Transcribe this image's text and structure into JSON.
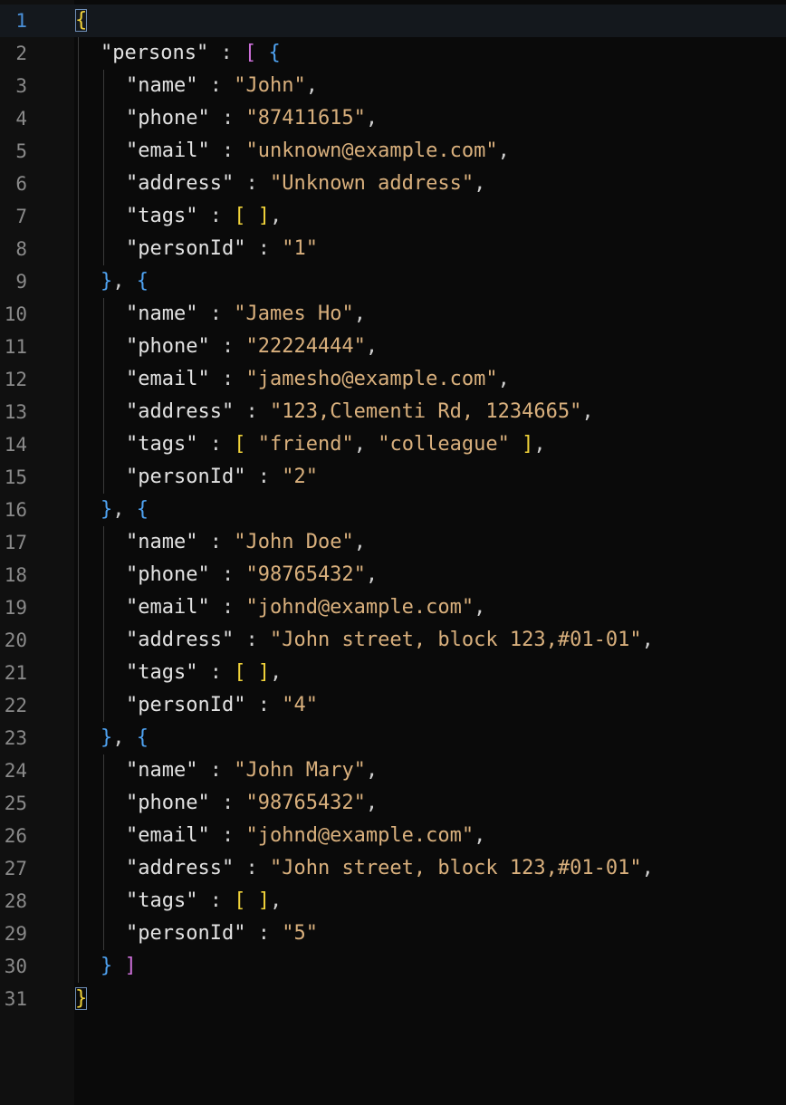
{
  "editor": {
    "colors": {
      "background": "#0a0a0a",
      "key": "#e2e2e2",
      "string": "#d9b07d",
      "bracket_level1": "#f1d33a",
      "bracket_level2": "#cc6fd8",
      "bracket_level3": "#4fa3f2",
      "line_number": "#8a8a8a",
      "current_line_number": "#4a90d9"
    },
    "current_line": 1,
    "lines": [
      {
        "n": "1",
        "indent": 0,
        "tokens": [
          {
            "t": "{",
            "c": "b1",
            "match": true
          }
        ]
      },
      {
        "n": "2",
        "indent": 1,
        "tokens": [
          {
            "t": "\"persons\"",
            "c": "key"
          },
          {
            "t": " : ",
            "c": "punc"
          },
          {
            "t": "[",
            "c": "b2"
          },
          {
            "t": " ",
            "c": "punc"
          },
          {
            "t": "{",
            "c": "b3"
          }
        ]
      },
      {
        "n": "3",
        "indent": 2,
        "tokens": [
          {
            "t": "\"name\"",
            "c": "key"
          },
          {
            "t": " : ",
            "c": "punc"
          },
          {
            "t": "\"John\"",
            "c": "str"
          },
          {
            "t": ",",
            "c": "punc"
          }
        ]
      },
      {
        "n": "4",
        "indent": 2,
        "tokens": [
          {
            "t": "\"phone\"",
            "c": "key"
          },
          {
            "t": " : ",
            "c": "punc"
          },
          {
            "t": "\"87411615\"",
            "c": "str"
          },
          {
            "t": ",",
            "c": "punc"
          }
        ]
      },
      {
        "n": "5",
        "indent": 2,
        "tokens": [
          {
            "t": "\"email\"",
            "c": "key"
          },
          {
            "t": " : ",
            "c": "punc"
          },
          {
            "t": "\"unknown@example.com\"",
            "c": "str"
          },
          {
            "t": ",",
            "c": "punc"
          }
        ]
      },
      {
        "n": "6",
        "indent": 2,
        "tokens": [
          {
            "t": "\"address\"",
            "c": "key"
          },
          {
            "t": " : ",
            "c": "punc"
          },
          {
            "t": "\"Unknown address\"",
            "c": "str"
          },
          {
            "t": ",",
            "c": "punc"
          }
        ]
      },
      {
        "n": "7",
        "indent": 2,
        "tokens": [
          {
            "t": "\"tags\"",
            "c": "key"
          },
          {
            "t": " : ",
            "c": "punc"
          },
          {
            "t": "[ ]",
            "c": "b1"
          },
          {
            "t": ",",
            "c": "punc"
          }
        ]
      },
      {
        "n": "8",
        "indent": 2,
        "tokens": [
          {
            "t": "\"personId\"",
            "c": "key"
          },
          {
            "t": " : ",
            "c": "punc"
          },
          {
            "t": "\"1\"",
            "c": "str"
          }
        ]
      },
      {
        "n": "9",
        "indent": 1,
        "tokens": [
          {
            "t": "}",
            "c": "b3"
          },
          {
            "t": ", ",
            "c": "punc"
          },
          {
            "t": "{",
            "c": "b3"
          }
        ]
      },
      {
        "n": "10",
        "indent": 2,
        "tokens": [
          {
            "t": "\"name\"",
            "c": "key"
          },
          {
            "t": " : ",
            "c": "punc"
          },
          {
            "t": "\"James Ho\"",
            "c": "str"
          },
          {
            "t": ",",
            "c": "punc"
          }
        ]
      },
      {
        "n": "11",
        "indent": 2,
        "tokens": [
          {
            "t": "\"phone\"",
            "c": "key"
          },
          {
            "t": " : ",
            "c": "punc"
          },
          {
            "t": "\"22224444\"",
            "c": "str"
          },
          {
            "t": ",",
            "c": "punc"
          }
        ]
      },
      {
        "n": "12",
        "indent": 2,
        "tokens": [
          {
            "t": "\"email\"",
            "c": "key"
          },
          {
            "t": " : ",
            "c": "punc"
          },
          {
            "t": "\"jamesho@example.com\"",
            "c": "str"
          },
          {
            "t": ",",
            "c": "punc"
          }
        ]
      },
      {
        "n": "13",
        "indent": 2,
        "tokens": [
          {
            "t": "\"address\"",
            "c": "key"
          },
          {
            "t": " : ",
            "c": "punc"
          },
          {
            "t": "\"123,Clementi Rd, 1234665\"",
            "c": "str"
          },
          {
            "t": ",",
            "c": "punc"
          }
        ]
      },
      {
        "n": "14",
        "indent": 2,
        "tokens": [
          {
            "t": "\"tags\"",
            "c": "key"
          },
          {
            "t": " : ",
            "c": "punc"
          },
          {
            "t": "[",
            "c": "b1"
          },
          {
            "t": " ",
            "c": "punc"
          },
          {
            "t": "\"friend\"",
            "c": "str"
          },
          {
            "t": ", ",
            "c": "punc"
          },
          {
            "t": "\"colleague\"",
            "c": "str"
          },
          {
            "t": " ",
            "c": "punc"
          },
          {
            "t": "]",
            "c": "b1"
          },
          {
            "t": ",",
            "c": "punc"
          }
        ]
      },
      {
        "n": "15",
        "indent": 2,
        "tokens": [
          {
            "t": "\"personId\"",
            "c": "key"
          },
          {
            "t": " : ",
            "c": "punc"
          },
          {
            "t": "\"2\"",
            "c": "str"
          }
        ]
      },
      {
        "n": "16",
        "indent": 1,
        "tokens": [
          {
            "t": "}",
            "c": "b3"
          },
          {
            "t": ", ",
            "c": "punc"
          },
          {
            "t": "{",
            "c": "b3"
          }
        ]
      },
      {
        "n": "17",
        "indent": 2,
        "tokens": [
          {
            "t": "\"name\"",
            "c": "key"
          },
          {
            "t": " : ",
            "c": "punc"
          },
          {
            "t": "\"John Doe\"",
            "c": "str"
          },
          {
            "t": ",",
            "c": "punc"
          }
        ]
      },
      {
        "n": "18",
        "indent": 2,
        "tokens": [
          {
            "t": "\"phone\"",
            "c": "key"
          },
          {
            "t": " : ",
            "c": "punc"
          },
          {
            "t": "\"98765432\"",
            "c": "str"
          },
          {
            "t": ",",
            "c": "punc"
          }
        ]
      },
      {
        "n": "19",
        "indent": 2,
        "tokens": [
          {
            "t": "\"email\"",
            "c": "key"
          },
          {
            "t": " : ",
            "c": "punc"
          },
          {
            "t": "\"johnd@example.com\"",
            "c": "str"
          },
          {
            "t": ",",
            "c": "punc"
          }
        ]
      },
      {
        "n": "20",
        "indent": 2,
        "tokens": [
          {
            "t": "\"address\"",
            "c": "key"
          },
          {
            "t": " : ",
            "c": "punc"
          },
          {
            "t": "\"John street, block 123,#01-01\"",
            "c": "str"
          },
          {
            "t": ",",
            "c": "punc"
          }
        ]
      },
      {
        "n": "21",
        "indent": 2,
        "tokens": [
          {
            "t": "\"tags\"",
            "c": "key"
          },
          {
            "t": " : ",
            "c": "punc"
          },
          {
            "t": "[ ]",
            "c": "b1"
          },
          {
            "t": ",",
            "c": "punc"
          }
        ]
      },
      {
        "n": "22",
        "indent": 2,
        "tokens": [
          {
            "t": "\"personId\"",
            "c": "key"
          },
          {
            "t": " : ",
            "c": "punc"
          },
          {
            "t": "\"4\"",
            "c": "str"
          }
        ]
      },
      {
        "n": "23",
        "indent": 1,
        "tokens": [
          {
            "t": "}",
            "c": "b3"
          },
          {
            "t": ", ",
            "c": "punc"
          },
          {
            "t": "{",
            "c": "b3"
          }
        ]
      },
      {
        "n": "24",
        "indent": 2,
        "tokens": [
          {
            "t": "\"name\"",
            "c": "key"
          },
          {
            "t": " : ",
            "c": "punc"
          },
          {
            "t": "\"John Mary\"",
            "c": "str"
          },
          {
            "t": ",",
            "c": "punc"
          }
        ]
      },
      {
        "n": "25",
        "indent": 2,
        "tokens": [
          {
            "t": "\"phone\"",
            "c": "key"
          },
          {
            "t": " : ",
            "c": "punc"
          },
          {
            "t": "\"98765432\"",
            "c": "str"
          },
          {
            "t": ",",
            "c": "punc"
          }
        ]
      },
      {
        "n": "26",
        "indent": 2,
        "tokens": [
          {
            "t": "\"email\"",
            "c": "key"
          },
          {
            "t": " : ",
            "c": "punc"
          },
          {
            "t": "\"johnd@example.com\"",
            "c": "str"
          },
          {
            "t": ",",
            "c": "punc"
          }
        ]
      },
      {
        "n": "27",
        "indent": 2,
        "tokens": [
          {
            "t": "\"address\"",
            "c": "key"
          },
          {
            "t": " : ",
            "c": "punc"
          },
          {
            "t": "\"John street, block 123,#01-01\"",
            "c": "str"
          },
          {
            "t": ",",
            "c": "punc"
          }
        ]
      },
      {
        "n": "28",
        "indent": 2,
        "tokens": [
          {
            "t": "\"tags\"",
            "c": "key"
          },
          {
            "t": " : ",
            "c": "punc"
          },
          {
            "t": "[ ]",
            "c": "b1"
          },
          {
            "t": ",",
            "c": "punc"
          }
        ]
      },
      {
        "n": "29",
        "indent": 2,
        "tokens": [
          {
            "t": "\"personId\"",
            "c": "key"
          },
          {
            "t": " : ",
            "c": "punc"
          },
          {
            "t": "\"5\"",
            "c": "str"
          }
        ]
      },
      {
        "n": "30",
        "indent": 1,
        "tokens": [
          {
            "t": "}",
            "c": "b3"
          },
          {
            "t": " ",
            "c": "punc"
          },
          {
            "t": "]",
            "c": "b2"
          }
        ]
      },
      {
        "n": "31",
        "indent": 0,
        "tokens": [
          {
            "t": "}",
            "c": "b1",
            "match": true
          }
        ]
      }
    ]
  }
}
